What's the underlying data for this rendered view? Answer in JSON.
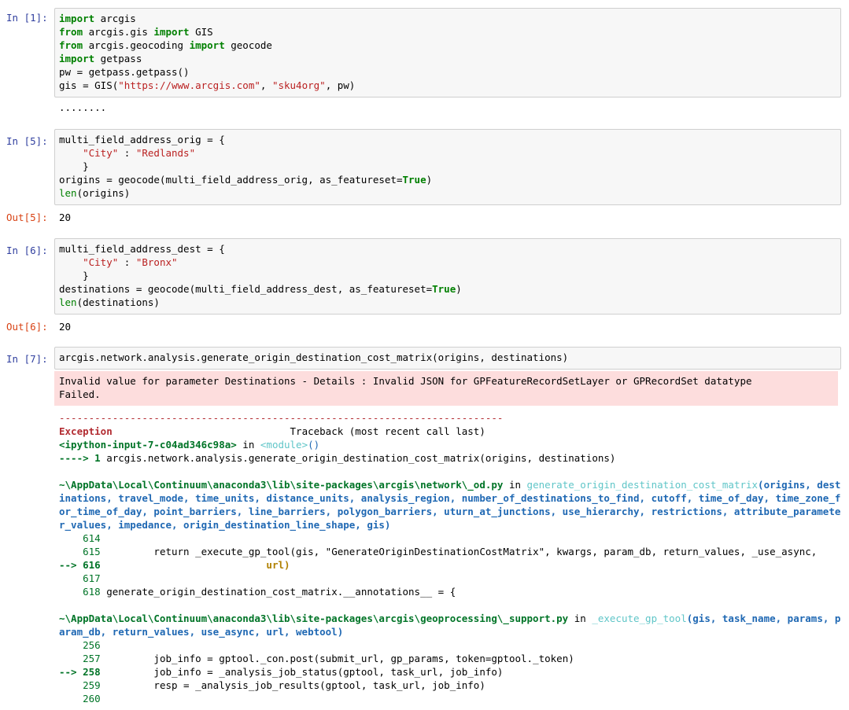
{
  "cells": [
    {
      "prompt": "In [1]:",
      "code": [
        "import arcgis",
        "from arcgis.gis import GIS",
        "from arcgis.geocoding import geocode",
        "import getpass",
        "pw = getpass.getpass()",
        "gis = GIS(\"https://www.arcgis.com\", \"sku4org\", pw)"
      ],
      "stdout": "........"
    },
    {
      "prompt": "In [5]:",
      "code": [
        "multi_field_address_orig = {",
        "    \"City\" : \"Redlands\"",
        "    }",
        "origins = geocode(multi_field_address_orig, as_featureset=True)",
        "len(origins)"
      ],
      "out_prompt": "Out[5]:",
      "out_value": "20"
    },
    {
      "prompt": "In [6]:",
      "code": [
        "multi_field_address_dest = {",
        "    \"City\" : \"Bronx\"",
        "    }",
        "destinations = geocode(multi_field_address_dest, as_featureset=True)",
        "len(destinations)"
      ],
      "out_prompt": "Out[6]:",
      "out_value": "20"
    },
    {
      "prompt": "In [7]:",
      "code": [
        "arcgis.network.analysis.generate_origin_destination_cost_matrix(origins, destinations)"
      ],
      "stderr": [
        "Invalid value for parameter Destinations - Details : Invalid JSON for GPFeatureRecordSetLayer or GPRecordSet datatype",
        "Failed."
      ]
    }
  ],
  "traceback": {
    "rule": "---------------------------------------------------------------------------",
    "exception": "Exception",
    "traceback_label": "Traceback (most recent call last)",
    "input_ref": "<ipython-input-7-c04ad346c98a>",
    "in_word": " in ",
    "module": "<module>",
    "module_parens": "()",
    "arrow1": "----> 1 ",
    "arrow1_code": "arcgis.network.analysis.generate_origin_destination_cost_matrix(origins, destinations)",
    "frame1_path": "~\\AppData\\Local\\Continuum\\anaconda3\\lib\\site-packages\\arcgis\\network\\_od.py",
    "frame1_func": "generate_origin_destination_cost_matrix",
    "frame1_args": "(origins, destinations, travel_mode, time_units, distance_units, analysis_region, number_of_destinations_to_find, cutoff, time_of_day, time_zone_for_time_of_day, point_barriers, line_barriers, polygon_barriers, uturn_at_junctions, use_hierarchy, restrictions, attribute_parameter_values, impedance, origin_destination_line_shape, gis)",
    "frame1_l614": "    614 ",
    "frame1_l615": "    615         return _execute_gp_tool(gis, \"GenerateOriginDestinationCostMatrix\", kwargs, param_db, return_values, _use_async,",
    "frame1_l615b": "url)",
    "frame1_l616_arrow": "--> 616 ",
    "frame1_l617": "    617 ",
    "frame1_l618": "    618 generate_origin_destination_cost_matrix.__annotations__ = {",
    "frame2_path": "~\\AppData\\Local\\Continuum\\anaconda3\\lib\\site-packages\\arcgis\\geoprocessing\\_support.py",
    "frame2_func": "_execute_gp_tool",
    "frame2_args": "(gis, task_name, params, param_db, return_values, use_async, url, webtool)",
    "frame2_l256": "    256 ",
    "frame2_l257": "    257         job_info = gptool._con.post(submit_url, gp_params, token=gptool._token)",
    "frame2_l258_arrow": "--> 258 ",
    "frame2_l258_code": "        job_info = _analysis_job_status(gptool, task_url, job_info)",
    "frame2_l259": "    259         resp = _analysis_job_results(gptool, task_url, job_info)",
    "frame2_l260": "    260 "
  },
  "colors": {
    "in_prompt": "#303f9f",
    "out_prompt": "#d84315",
    "keyword": "#008000",
    "string": "#ba2121",
    "error_bg": "#fddddd"
  }
}
